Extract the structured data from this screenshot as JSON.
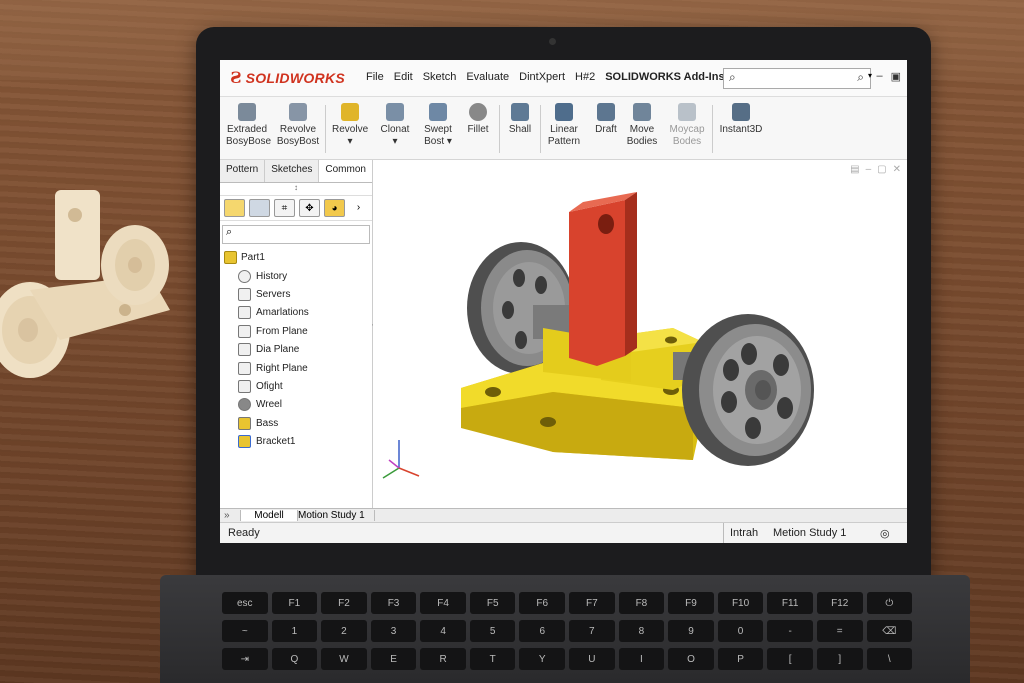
{
  "app": {
    "logo_mark": "Ƨ",
    "logo_text": "SOLIDWORKS"
  },
  "menu": [
    "File",
    "Edit",
    "Sketch",
    "Evaluate",
    "DintXpert",
    "H#2",
    "SOLIDWORKS Add-Ins"
  ],
  "search": {
    "icon": "search-icon",
    "icon2": "search-icon"
  },
  "toolbar": [
    {
      "line1": "Extraded",
      "line2": "BosyBose",
      "color": "#7b8a9a"
    },
    {
      "line1": "Revolve",
      "line2": "BosyBost",
      "color": "#8795a6"
    },
    {
      "line1": "Revolve",
      "line2": "▾",
      "color": "#e0b52a"
    },
    {
      "line1": "Clonat",
      "line2": "▾",
      "color": "#7a8fa6"
    },
    {
      "line1": "Swept",
      "line2": "Bost ▾",
      "color": "#6e88a5"
    },
    {
      "line1": "Fillet",
      "line2": "",
      "color": "#888888"
    },
    {
      "line1": "Shall",
      "line2": "",
      "color": "#5f7a95"
    },
    {
      "line1": "Linear",
      "line2": "Pattern",
      "color": "#4f6d8c"
    },
    {
      "line1": "Draft",
      "line2": "",
      "color": "#5d7690"
    },
    {
      "line1": "Move",
      "line2": "Bodies",
      "color": "#70859a"
    },
    {
      "line1": "Moycap",
      "line2": "Bodes",
      "color": "#b9c1c9"
    },
    {
      "line1": "Instant3D",
      "line2": "",
      "color": "#566e86"
    }
  ],
  "panel": {
    "tabs": [
      "Pottern",
      "Sketches",
      "Common"
    ],
    "arrow": "↕",
    "root": "Part1",
    "items": [
      "History",
      "Servers",
      "Amarlations",
      "From Plane",
      "Dia Plane",
      "Right Plane",
      "Ofight",
      "Wreel",
      "Bass",
      "Bracket1"
    ]
  },
  "bottom_tabs": {
    "arrows": "»",
    "model": "Modell",
    "motion": "Motion Study 1"
  },
  "status": {
    "left": "Ready",
    "mid": "Intrah",
    "right": "Metion Study 1",
    "icon": "◎"
  },
  "colors": {
    "part_yellow": "#e8d21a",
    "bracket_red": "#d8432d",
    "wheel": "#6a6a6a",
    "brand": "#d0331f"
  },
  "keyboard": {
    "row1": [
      "esc",
      "F1",
      "F2",
      "F3",
      "F4",
      "F5",
      "F6",
      "F7",
      "F8",
      "F9",
      "F10",
      "F11",
      "F12",
      "⏻"
    ],
    "row2": [
      "~",
      "1",
      "2",
      "3",
      "4",
      "5",
      "6",
      "7",
      "8",
      "9",
      "0",
      "-",
      "=",
      "⌫"
    ],
    "row3": [
      "⇥",
      "Q",
      "W",
      "E",
      "R",
      "T",
      "Y",
      "U",
      "I",
      "O",
      "P",
      "[",
      "]",
      "\\"
    ]
  }
}
